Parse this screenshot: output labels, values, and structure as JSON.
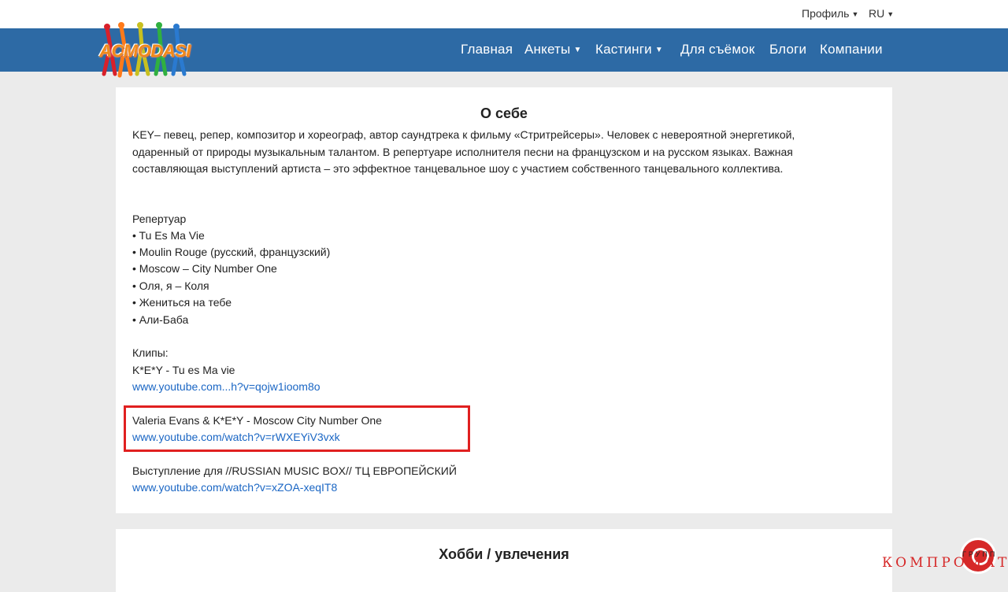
{
  "topbar": {
    "profile": "Профиль",
    "lang": "RU"
  },
  "logo": {
    "text": "ACMODASI"
  },
  "nav": {
    "home": "Главная",
    "profiles": "Анкеты",
    "castings": "Кастинги",
    "filming": "Для съёмок",
    "blogs": "Блоги",
    "companies": "Компании"
  },
  "about": {
    "title": "О себе",
    "intro": "KEY– певец, репер, композитор и хореограф, автор саундтрека к фильму «Стритрейсеры». Человек с невероятной энергетикой, одаренный от природы музыкальным талантом. В репертуаре исполнителя песни на французском и на русском языках. Важная составляющая выступлений артиста – это эффектное танцевальное шоу с участием собственного танцевального коллектива.",
    "repertoire_title": "Репертуар",
    "repertoire": [
      "• Tu Es Ma Vie",
      "• Moulin Rouge (русский, французский)",
      "• Moscow – City Number One",
      "• Оля, я – Коля",
      "• Жениться на тебе",
      "• Али-Баба"
    ],
    "clips_title": "Клипы:",
    "clips": [
      {
        "title": "K*E*Y - Tu es Ma vie",
        "url": "www.youtube.com...h?v=qojw1ioom8o"
      },
      {
        "title": "Valeria Evans & K*E*Y - Moscow City Number One",
        "url": "www.youtube.com/watch?v=rWXEYiV3vxk"
      },
      {
        "title": "Выступление для //RUSSIAN MUSIC BOX// ТЦ ЕВРОПЕЙСКИЙ",
        "url": "www.youtube.com/watch?v=xZOA-xeqIT8"
      }
    ]
  },
  "hobbies": {
    "title": "Хобби / увлечения"
  },
  "watermark": {
    "text": "КОМПРОМАТ",
    "small": "ГРУПП"
  },
  "colors": {
    "navbar": "#2d6aa5",
    "link": "#1a66c4",
    "highlight": "#e02020",
    "background": "#ebebeb"
  }
}
